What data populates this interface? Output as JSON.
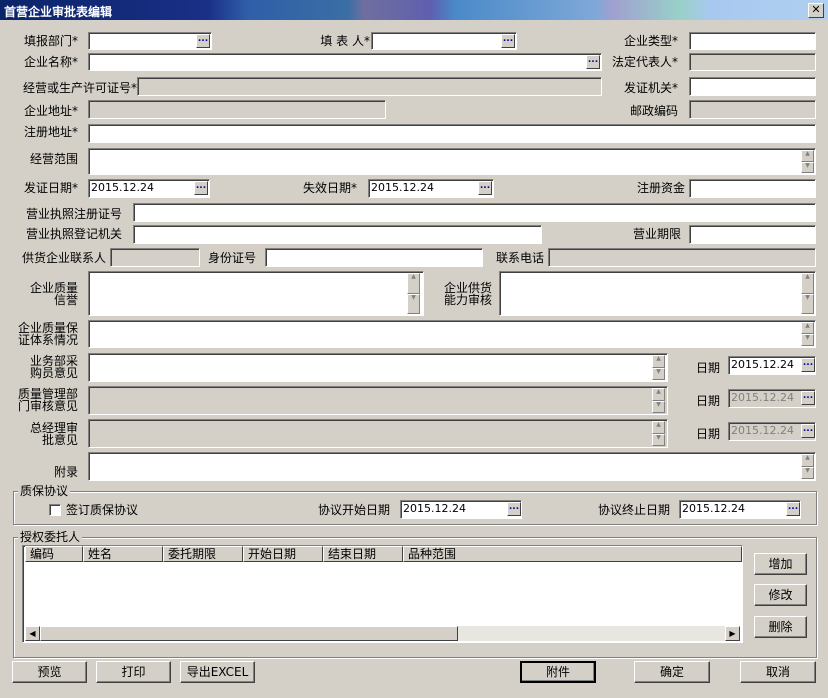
{
  "window": {
    "title": "首营企业审批表编辑",
    "close": "✕"
  },
  "icons": {
    "dots": "...",
    "spin_up": "▲",
    "spin_down": "▼",
    "arrow_left": "◀",
    "arrow_right": "▶"
  },
  "form": {
    "fill_dept": {
      "label": "填报部门*",
      "value": ""
    },
    "filler": {
      "label": "填 表 人*",
      "value": ""
    },
    "ent_type": {
      "label": "企业类型*",
      "value": ""
    },
    "ent_name": {
      "label": "企业名称*",
      "value": ""
    },
    "legal_rep": {
      "label": "法定代表人*",
      "value": ""
    },
    "license_no": {
      "label": "经营或生产许可证号*",
      "value": ""
    },
    "issuer": {
      "label": "发证机关*",
      "value": ""
    },
    "ent_addr": {
      "label": "企业地址*",
      "value": ""
    },
    "postcode": {
      "label": "邮政编码",
      "value": ""
    },
    "reg_addr": {
      "label": "注册地址*",
      "value": ""
    },
    "scope": {
      "label": "经营范围",
      "value": ""
    },
    "issue_date": {
      "label": "发证日期*",
      "value": "2015.12.24"
    },
    "expire_date": {
      "label": "失效日期*",
      "value": "2015.12.24"
    },
    "reg_capital": {
      "label": "注册资金",
      "value": ""
    },
    "biz_reg_no": {
      "label": "营业执照注册证号",
      "value": ""
    },
    "biz_reg_org": {
      "label": "营业执照登记机关",
      "value": ""
    },
    "biz_term": {
      "label": "营业期限",
      "value": ""
    },
    "contact": {
      "label": "供货企业联系人",
      "value": ""
    },
    "id_no": {
      "label": "身份证号",
      "value": ""
    },
    "phone": {
      "label": "联系电话",
      "value": ""
    },
    "quality_rep_l1": "企业质量",
    "quality_rep_l2": "信誉",
    "supply_l1": "企业供货",
    "supply_l2": "能力审核",
    "qa_sys_l1": "企业质量保",
    "qa_sys_l2": "证体系情况",
    "purch_l1": "业务部采",
    "purch_l2": "购员意见",
    "qm_l1": "质量管理部",
    "qm_l2": "门审核意见",
    "gm_l1": "总经理审",
    "gm_l2": "批意见",
    "date_label": "日期",
    "purch_date": "2015.12.24",
    "qm_date": "2015.12.24",
    "gm_date": "2015.12.24",
    "appendix": "附录"
  },
  "agreement": {
    "title": "质保协议",
    "sign_label": "签订质保协议",
    "start_label": "协议开始日期",
    "start_value": "2015.12.24",
    "end_label": "协议终止日期",
    "end_value": "2015.12.24"
  },
  "delegate": {
    "title": "授权委托人",
    "columns": [
      "编码",
      "姓名",
      "委托期限",
      "开始日期",
      "结束日期",
      "品种范围"
    ],
    "add": "增加",
    "edit": "修改",
    "delete": "删除"
  },
  "footer": {
    "preview": "预览",
    "print": "打印",
    "export": "导出EXCEL",
    "attach": "附件",
    "ok": "确定",
    "cancel": "取消"
  }
}
